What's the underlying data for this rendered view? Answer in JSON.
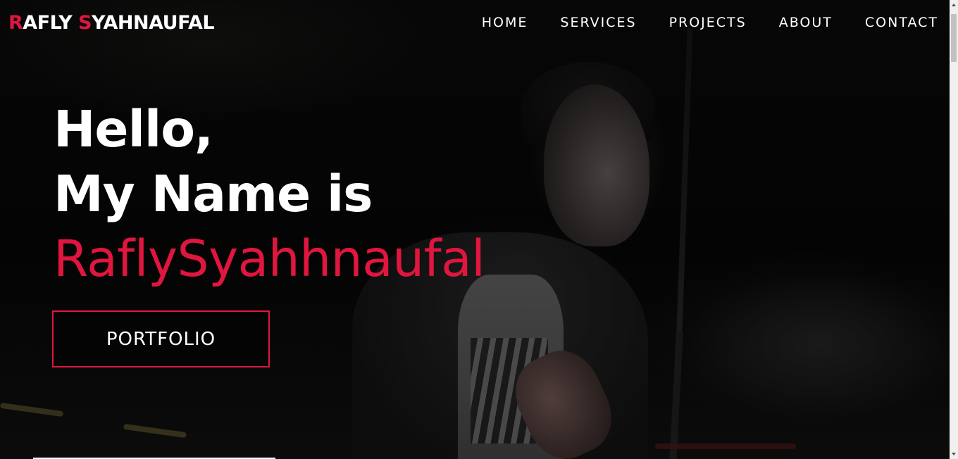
{
  "brand": {
    "first_initial": "R",
    "first_rest": "AFLY ",
    "last_initial": "S",
    "last_rest": "YAHNAUFAL"
  },
  "nav": {
    "items": [
      {
        "label": "HOME"
      },
      {
        "label": "SERVICES"
      },
      {
        "label": "PROJECTS"
      },
      {
        "label": "ABOUT"
      },
      {
        "label": "CONTACT"
      }
    ]
  },
  "hero": {
    "line1": "Hello,",
    "line2": "My Name is",
    "name": "RaflySyahhnaufal",
    "button_label": "PORTFOLIO"
  },
  "colors": {
    "accent": "#e0163f",
    "text": "#ffffff",
    "background": "#000000"
  },
  "icons": {
    "scroll_up": "chevron-up-icon",
    "scroll_down": "chevron-down-icon"
  }
}
